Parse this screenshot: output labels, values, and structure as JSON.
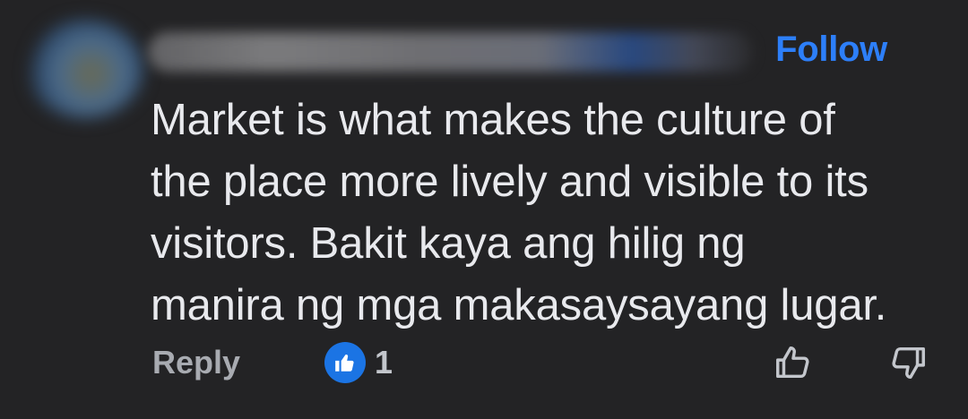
{
  "comment": {
    "author_name": "",
    "follow_label": "Follow",
    "text": "Market is what makes the culture of the place more lively and visible to its visitors. Bakit kaya ang hilig ng manira ng mga makasaysayang lugar.",
    "lines": [
      "Market is what makes the culture of",
      "the place more lively and visible to its",
      "visitors. Bakit kaya ang hilig ng",
      "manira ng mga makasaysayang lugar."
    ]
  },
  "actions": {
    "reply_label": "Reply",
    "reaction_icon": "like-icon",
    "reaction_count": "1",
    "upvote_icon": "thumbs-up-outline-icon",
    "downvote_icon": "thumbs-down-outline-icon"
  },
  "colors": {
    "background": "#232325",
    "follow": "#2d7ff9",
    "like_badge": "#1b74e4",
    "text": "#e8e9ed",
    "muted": "#a8abb1"
  }
}
